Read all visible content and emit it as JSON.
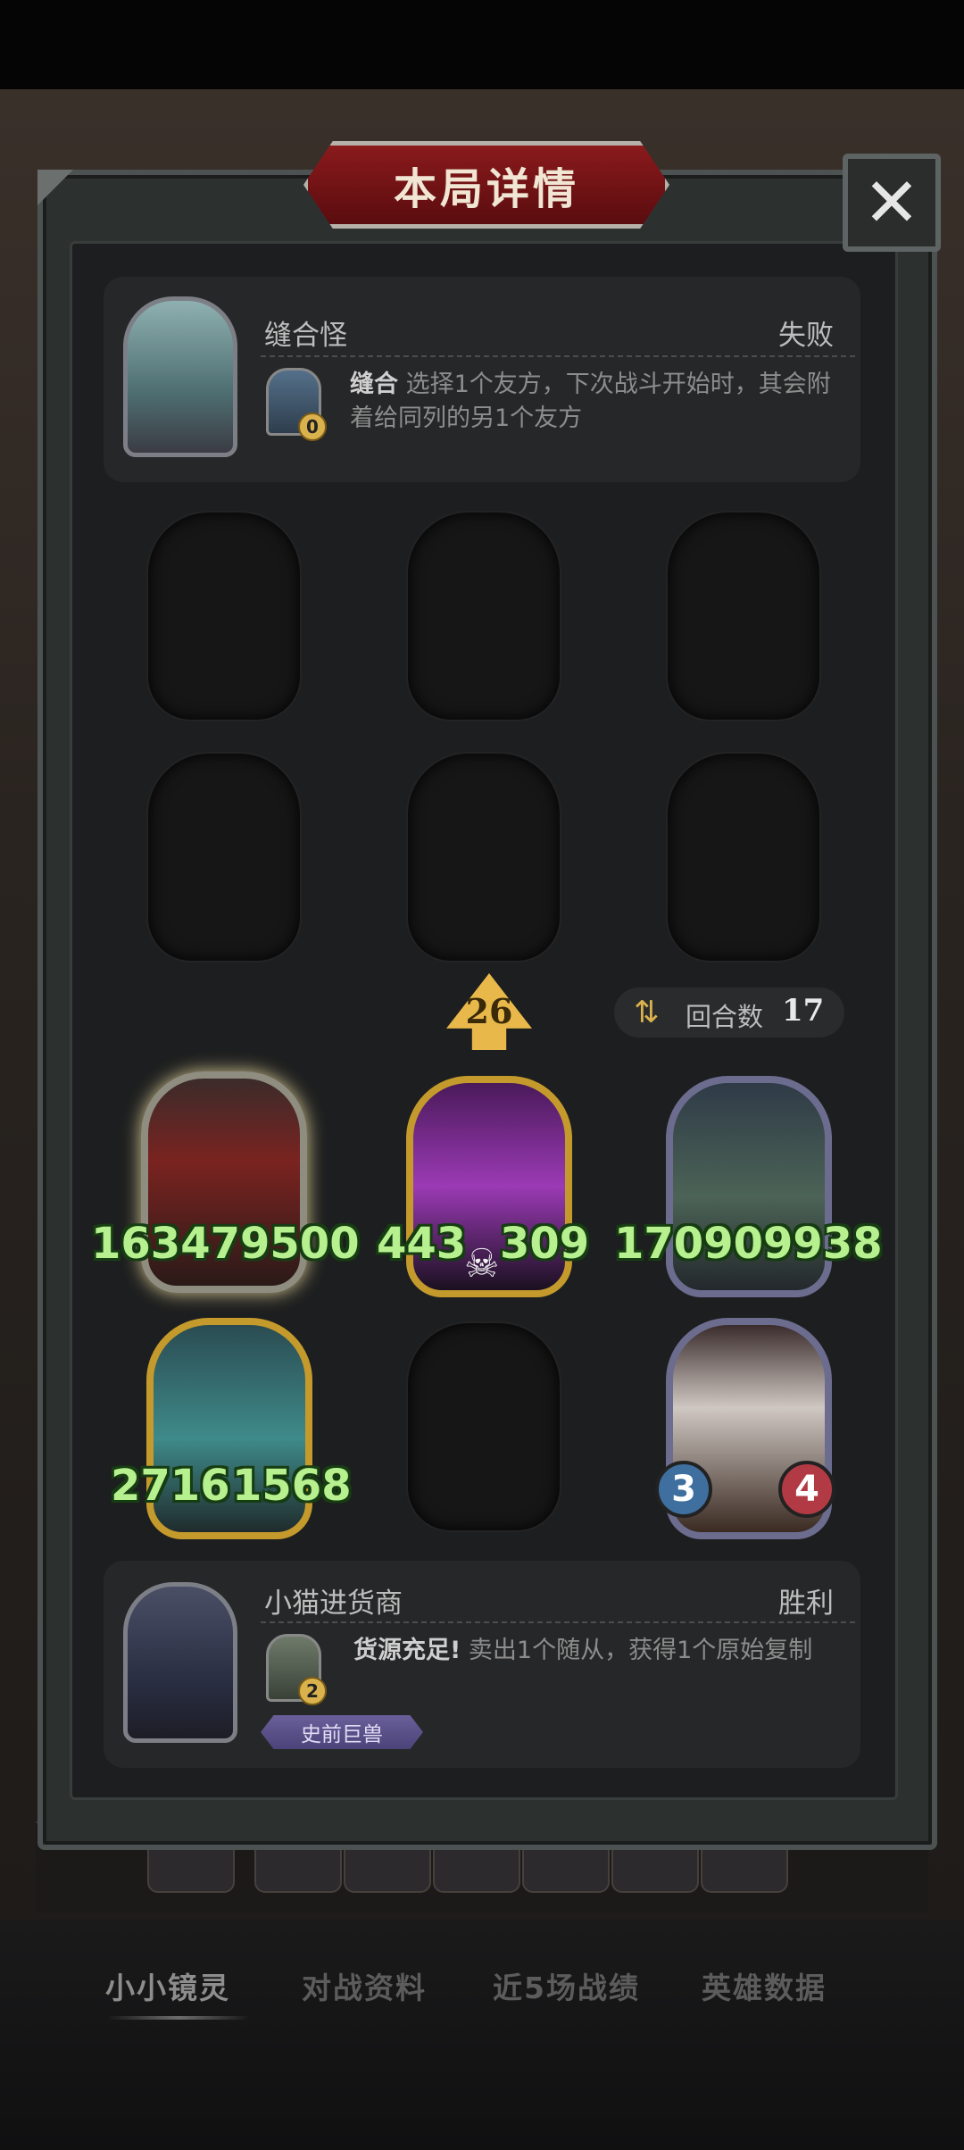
{
  "title": "本局详情",
  "close": "✕",
  "enemy_hero": {
    "name": "缝合怪",
    "result": "失败",
    "skill_cost": "0",
    "skill_name": "缝合",
    "skill_desc": "选择1个友方，下次战斗开始时，其会附着给同列的另1个友方"
  },
  "tier": "26",
  "turns": {
    "label": "回合数",
    "value": "17",
    "icon": "swap-arrows-icon"
  },
  "board": {
    "top_row": [
      {
        "attack": "163479500",
        "health": ""
      },
      {
        "attack": "443",
        "health": "309"
      },
      {
        "attack": "170909938",
        "health": ""
      }
    ],
    "bottom_row": [
      {
        "attack": "2716",
        "health": "1568"
      },
      {
        "attack": "3",
        "health": "4"
      }
    ]
  },
  "my_hero": {
    "name": "小猫进货商",
    "result": "胜利",
    "skill_cost": "2",
    "skill_name": "货源充足!",
    "skill_desc": "卖出1个随从，获得1个原始复制",
    "tribe": "史前巨兽"
  },
  "nav": [
    "小小镜灵",
    "对战资料",
    "近5场战绩",
    "英雄数据"
  ]
}
